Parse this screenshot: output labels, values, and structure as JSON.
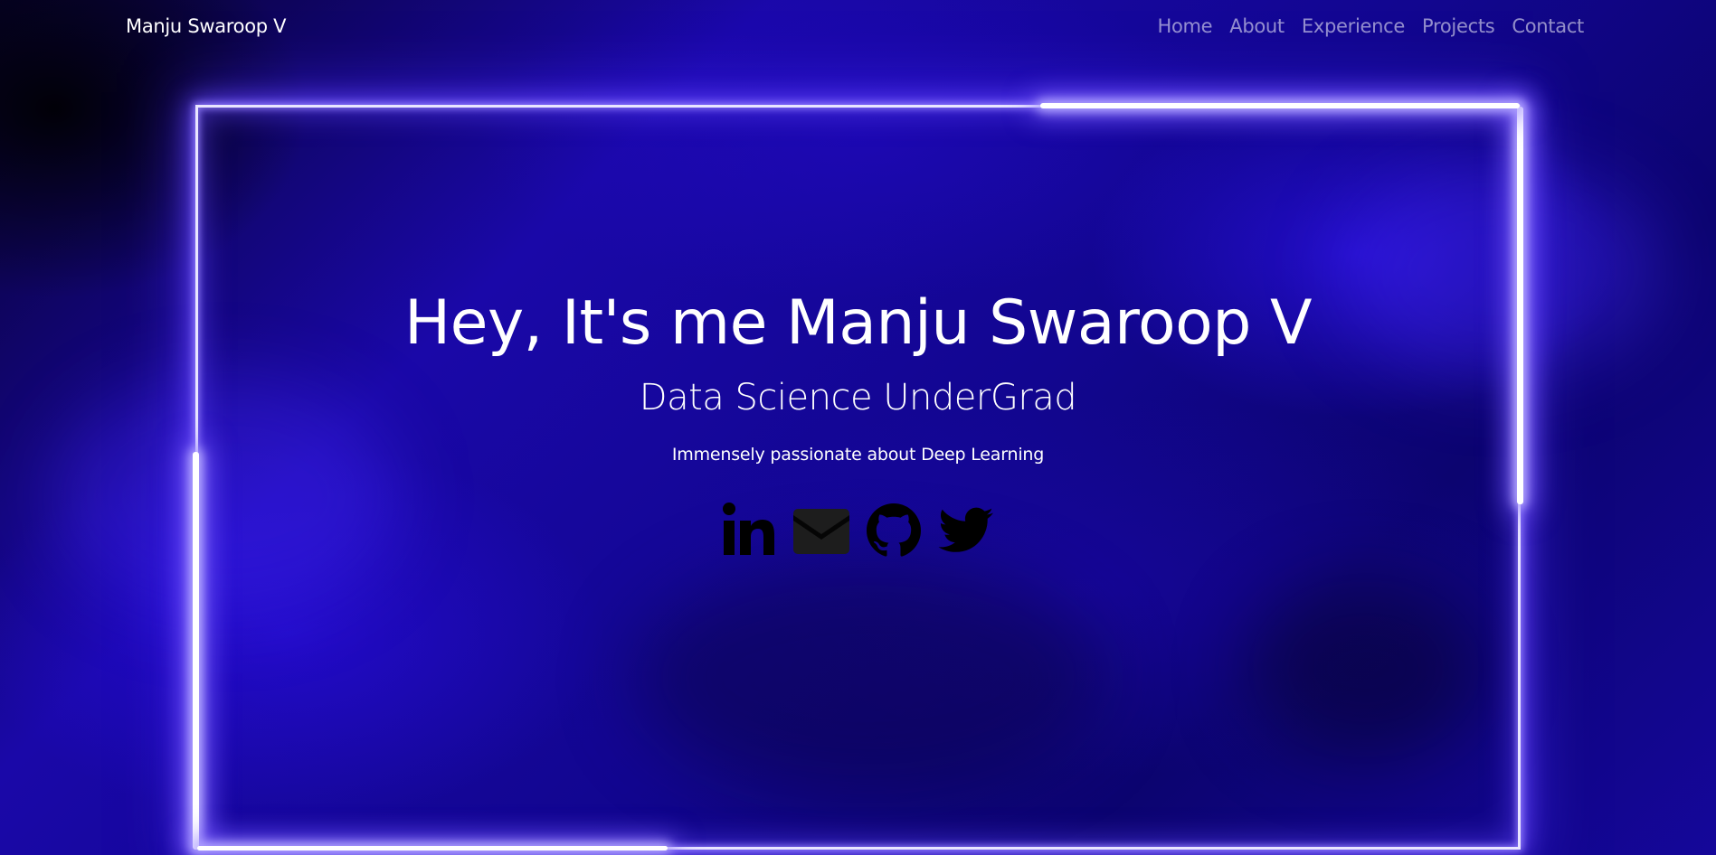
{
  "nav": {
    "brand": "Manju Swaroop V",
    "links": [
      {
        "label": "Home"
      },
      {
        "label": "About"
      },
      {
        "label": "Experience"
      },
      {
        "label": "Projects"
      },
      {
        "label": "Contact"
      }
    ]
  },
  "hero": {
    "title": "Hey, It's me Manju Swaroop V",
    "subtitle": "Data Science UnderGrad",
    "tagline": "Immensely passionate about Deep Learning"
  },
  "social": {
    "icons": [
      "linkedin-icon",
      "email-icon",
      "github-icon",
      "twitter-icon"
    ]
  },
  "colors": {
    "background": "#1a08a8",
    "neon_frame": "#e9e6ff",
    "nav_link": "rgba(255,255,255,0.55)",
    "icon": "#000000"
  }
}
